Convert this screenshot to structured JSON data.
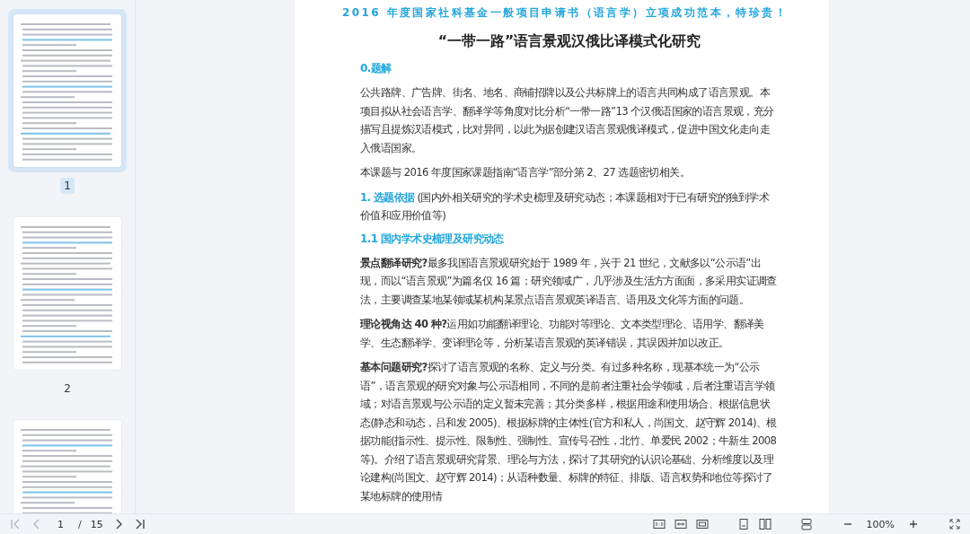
{
  "thumbnails": [
    {
      "label": "1",
      "selected": true
    },
    {
      "label": "2",
      "selected": false
    },
    {
      "selected": false
    }
  ],
  "document": {
    "blocks": [
      {
        "kind": "banner",
        "text": "2016 年度国家社科基金一般项目申请书（语言学）立项成功范本，特珍贵！"
      },
      {
        "kind": "title",
        "text": "“一带一路”语言景观汉俄比译模式化研究"
      },
      {
        "kind": "heading",
        "text": "0.题解"
      },
      {
        "kind": "paragraph",
        "text": "公共路牌、广告牌、街名、地名、商铺招牌以及公共标牌上的语言共同构成了语言景观。本项目拟从社会语言学、翻译学等角度对比分析“一带一路”13 个汉俄语国家的语言景观，充分描写且提炼汉语模式，比对异同，以此为据创建汉语言景观俄译模式，促进中国文化走向走入俄语国家。"
      },
      {
        "kind": "paragraph",
        "text": "本课题与 2016 年度国家课题指南“语言学”部分第 2、27 选题密切相关。"
      },
      {
        "kind": "section",
        "text": "1. 选题依据",
        "note": "(国内外相关研究的学术史梳理及研究动态；本课题相对于已有研究的独到学术价值和应用价值等)"
      },
      {
        "kind": "heading",
        "text": "1.1 国内学术史梳理及研究动态"
      },
      {
        "kind": "paragraph",
        "text": "**景点翻译研究?**最多我国语言景观研究始于 1989 年，兴于 21 世纪，文献多以“公示语”出现，而以“语言景观”为篇名仅 16 篇；研究领域广，几乎涉及生活方方面面，多采用实证调查法，主要调查某地某领域某机构某景点语言景观英译语言、语用及文化等方面的问题。"
      },
      {
        "kind": "paragraph",
        "text": "**理论视角达 40 种?**运用如功能翻译理论、功能对等理论、文本类型理论、语用学、翻译美学、生态翻译学、变译理论等，分析某语言景观的英译错误，其误因并加以改正。"
      },
      {
        "kind": "paragraph",
        "text": "**基本问题研究?**探讨了语言景观的名称、定义与分类。有过多种名称，现基本统一为“公示语”，语言景观的研究对象与公示语相同，不同的是前者注重社会学领域，后者注重语言学领域；对语言景观与公示语的定义暂未完善；其分类多样，根据用途和使用场合、根据信息状态(静态和动态，吕和发 2005)、根据标牌的主体性(官方和私人，尚国文、赵守辉 2014)、根据功能(指示性、提示性、限制性、强制性、宣传号召性，北竹、单爱民 2002；牛新生 2008 等)。介绍了语言景观研究背景、理论与方法，探讨了其研究的认识论基础、分析维度以及理论建构(尚国文、赵守辉 2014)；从语种数量、标牌的特征、排版、语言权势和地位等探讨了某地标牌的使用情"
      }
    ]
  },
  "toolbar": {
    "page": "1",
    "separator": "/",
    "total": "15",
    "zoom": "100%"
  }
}
